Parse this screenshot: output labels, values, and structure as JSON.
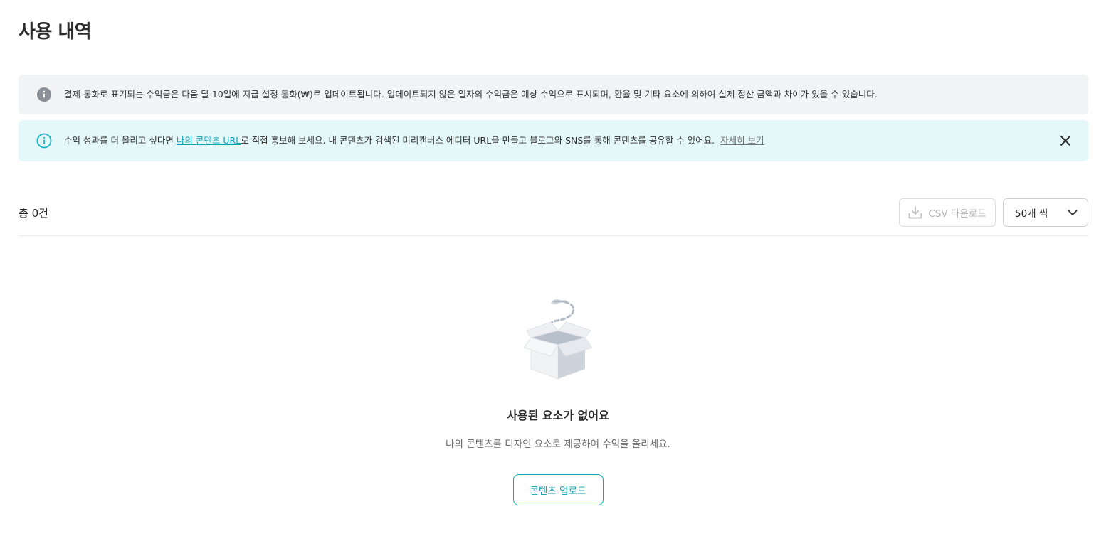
{
  "page": {
    "title": "사용 내역"
  },
  "notices": {
    "info": {
      "icon": "info-filled-icon",
      "text": "결제 통화로 표기되는 수익금은 다음 달 10일에 지급 설정 통화(₩)로 업데이트됩니다. 업데이트되지 않은 일자의 수익금은 예상 수익으로 표시되며, 환율 및 기타 요소에 의하여 실제 정산 금액과 차이가 있을 수 있습니다."
    },
    "promo": {
      "icon": "info-outline-icon",
      "text_before": "수익 성과를 더 올리고 싶다면 ",
      "link_label": "나의 콘텐츠 URL",
      "text_after": "로 직접 홍보해 보세요. 내 콘텐츠가 검색된 미리캔버스 에디터 URL을 만들고 블로그와 SNS를 통해 콘텐츠를 공유할 수 있어요.",
      "detail_label": "자세히 보기",
      "close_icon": "close-icon"
    }
  },
  "toolbar": {
    "total": "총 0건",
    "csv_label": "CSV 다운로드",
    "csv_icon": "download-icon",
    "page_size": "50개 씩",
    "page_size_icon": "chevron-down-icon"
  },
  "empty_state": {
    "illustration": "empty-box-icon",
    "title": "사용된 요소가 없어요",
    "description": "나의 콘텐츠를 디자인 요소로 제공하여 수익을 올리세요.",
    "button_label": "콘텐츠 업로드"
  },
  "colors": {
    "accent": "#12a7b6",
    "info_bg": "#f2f3f5",
    "promo_bg": "#e4f7f9"
  }
}
